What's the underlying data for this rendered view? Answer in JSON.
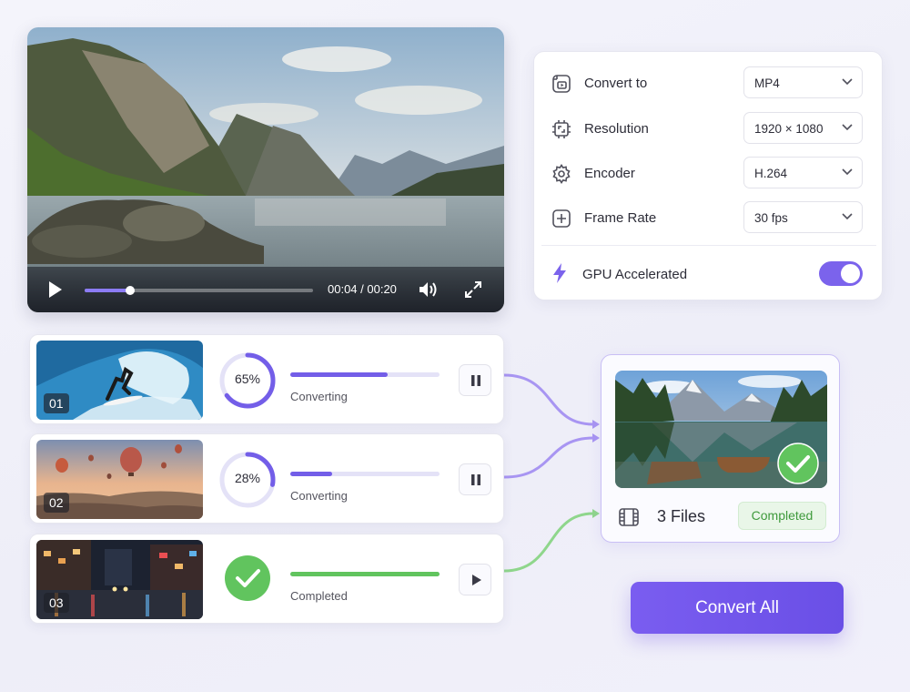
{
  "player": {
    "time": "00:04 / 00:20",
    "progress": 0.2
  },
  "settings": {
    "rows": [
      {
        "label": "Convert to",
        "value": "MP4",
        "icon": "video-file-icon"
      },
      {
        "label": "Resolution",
        "value": "1920 × 1080",
        "icon": "resolution-icon"
      },
      {
        "label": "Encoder",
        "value": "H.264",
        "icon": "gear-icon"
      },
      {
        "label": "Frame Rate",
        "value": "30 fps",
        "icon": "frame-rate-icon"
      }
    ],
    "gpu": {
      "label": "GPU Accelerated",
      "enabled": true,
      "icon": "lightning-icon"
    }
  },
  "queue": [
    {
      "index": "01",
      "progress": 0.65,
      "progress_label": "65%",
      "status": "Converting",
      "action": "pause",
      "scene": "surfer"
    },
    {
      "index": "02",
      "progress": 0.28,
      "progress_label": "28%",
      "status": "Converting",
      "action": "pause",
      "scene": "balloons"
    },
    {
      "index": "03",
      "progress": 1.0,
      "progress_label": "",
      "status": "Completed",
      "action": "play",
      "scene": "city-night"
    }
  ],
  "output": {
    "files": "3 Files",
    "status": "Completed"
  },
  "convert_all": "Convert All",
  "colors": {
    "accent": "#7b63ec",
    "success": "#61c45e",
    "track": "#e4e2f7"
  }
}
